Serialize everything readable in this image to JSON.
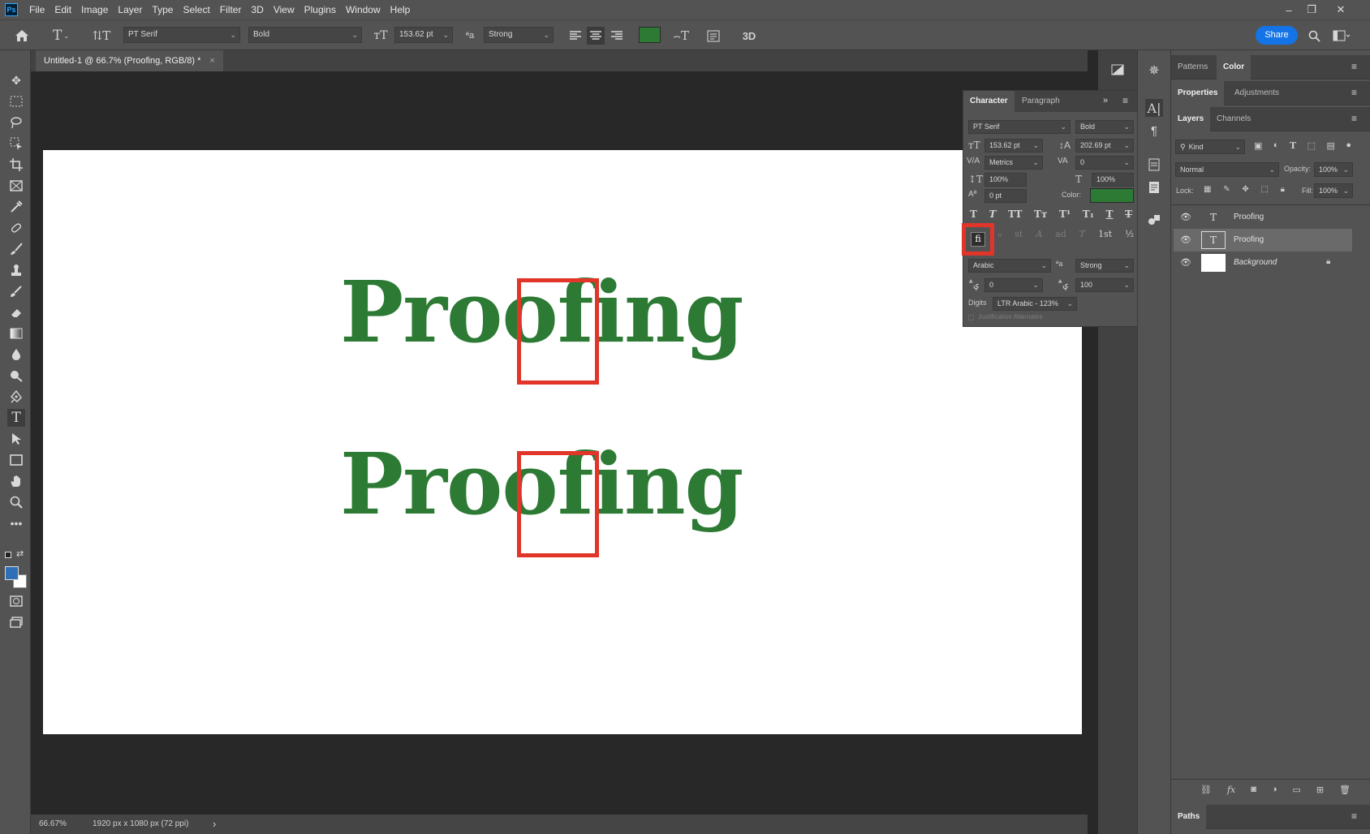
{
  "menubar": {
    "logo": "Ps",
    "items": [
      "File",
      "Edit",
      "Image",
      "Layer",
      "Type",
      "Select",
      "Filter",
      "3D",
      "View",
      "Plugins",
      "Window",
      "Help"
    ]
  },
  "options": {
    "font_family": "PT Serif",
    "font_style": "Bold",
    "font_size": "153.62 pt",
    "antialias": "Strong",
    "text_color": "#2c7a34",
    "share_label": "Share",
    "three_d": "3D"
  },
  "document": {
    "tab_title": "Untitled-1 @ 66.7% (Proofing, RGB/8) *",
    "close": "×",
    "text_line_1": "Proofing",
    "text_line_2": "Proofing",
    "text_color": "#2c7a34",
    "highlight_color": "#e1352a"
  },
  "status": {
    "zoom": "66.67%",
    "doc_info": "1920 px x 1080 px (72 ppi)",
    "arrow": "›"
  },
  "character": {
    "tab_character": "Character",
    "tab_paragraph": "Paragraph",
    "font_family": "PT Serif",
    "font_style": "Bold",
    "size": "153.62 pt",
    "leading": "202.69 pt",
    "kerning": "Metrics",
    "tracking": "0",
    "vscale": "100%",
    "hscale": "100%",
    "baseline": "0 pt",
    "color_label": "Color:",
    "color": "#2c7a34",
    "style_buttons": [
      "T",
      "T",
      "TT",
      "Tт",
      "T¹",
      "T₁",
      "T",
      "T"
    ],
    "opentype_buttons": [
      "fi",
      "ℴ",
      "st",
      "A",
      "ad",
      "T",
      "1st",
      "½"
    ],
    "language": "Arabic",
    "aa": "Strong",
    "kashida_a": "0",
    "kashida_b": "100",
    "digits_label": "Digits",
    "digits_value": "LTR Arabic - 123%",
    "justification_alternates": "Justification Alternates"
  },
  "right": {
    "tabs1": [
      "Patterns",
      "Color"
    ],
    "tabs2": [
      "Properties",
      "Adjustments"
    ],
    "tabs3": [
      "Layers",
      "Channels"
    ],
    "kind": "Kind",
    "blend": "Normal",
    "opacity_label": "Opacity:",
    "opacity": "100%",
    "lock_label": "Lock:",
    "fill_label": "Fill:",
    "fill": "100%",
    "layers": [
      {
        "name": "Proofing",
        "type": "text"
      },
      {
        "name": "Proofing",
        "type": "text"
      },
      {
        "name": "Background",
        "type": "image"
      }
    ],
    "paths_tab": "Paths"
  }
}
